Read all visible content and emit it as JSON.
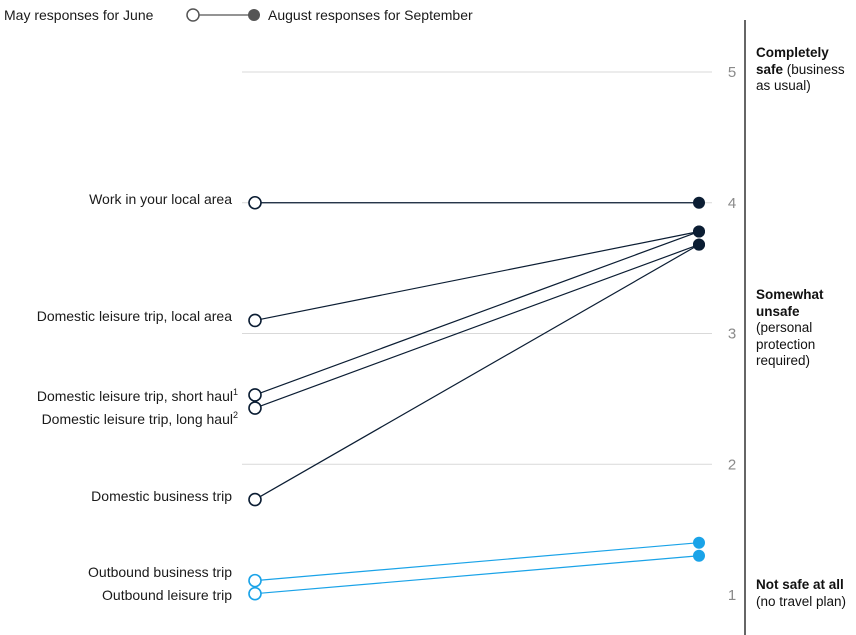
{
  "legend": {
    "june_label": "May responses for June",
    "sept_label": "August responses for September"
  },
  "annotations": [
    {
      "title": "Completely safe",
      "detail": "(business as usual)"
    },
    {
      "title": "Somewhat unsafe",
      "detail": "(personal protection required)"
    },
    {
      "title": "Not safe at all",
      "detail": "(no travel plan)"
    }
  ],
  "colors": {
    "domestic": "#0b1d33",
    "outbound": "#1aa3e8",
    "grid": "#d9d9d9",
    "tick": "#8a8a8a",
    "axis": "#333333"
  },
  "chart_data": {
    "type": "slope",
    "ylim": [
      1,
      5
    ],
    "yticks": [
      1,
      2,
      3,
      4,
      5
    ],
    "grid": true,
    "series_labels": [
      "June",
      "September"
    ],
    "series": [
      {
        "name": "Work in your local area",
        "sup": "",
        "june": 4.0,
        "september": 4.0,
        "group": "domestic"
      },
      {
        "name": "Domestic leisure trip, local area",
        "sup": "",
        "june": 3.1,
        "september": 3.78,
        "group": "domestic"
      },
      {
        "name": "Domestic leisure trip, short haul",
        "sup": "1",
        "june": 2.53,
        "september": 3.78,
        "group": "domestic"
      },
      {
        "name": "Domestic leisure trip, long haul",
        "sup": "2",
        "june": 2.43,
        "september": 3.68,
        "group": "domestic"
      },
      {
        "name": "Domestic business trip",
        "sup": "",
        "june": 1.73,
        "september": 3.68,
        "group": "domestic"
      },
      {
        "name": "Outbound business trip",
        "sup": "",
        "june": 1.11,
        "september": 1.4,
        "group": "outbound"
      },
      {
        "name": "Outbound leisure trip",
        "sup": "",
        "june": 1.01,
        "september": 1.3,
        "group": "outbound"
      }
    ]
  }
}
